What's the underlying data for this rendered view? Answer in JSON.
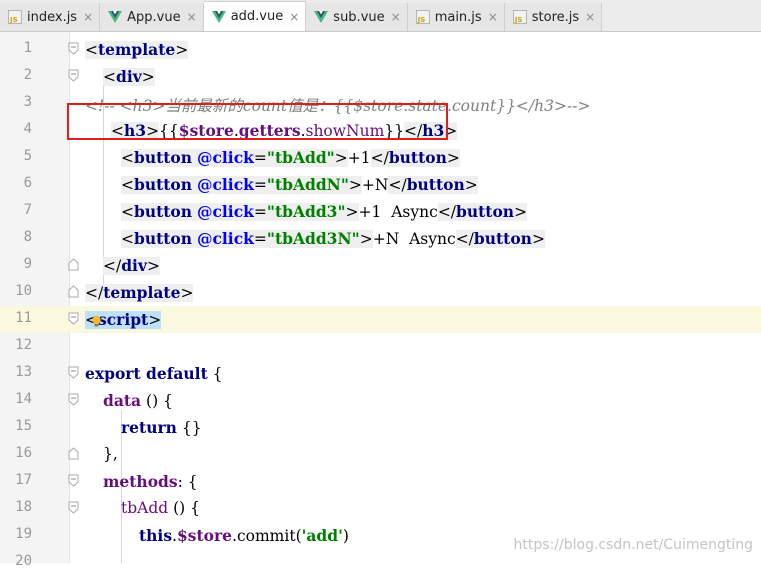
{
  "tabs": [
    {
      "label": "index.js",
      "icon": "js-file-icon",
      "active": false
    },
    {
      "label": "App.vue",
      "icon": "vue-file-icon",
      "active": false
    },
    {
      "label": "add.vue",
      "icon": "vue-file-icon",
      "active": true
    },
    {
      "label": "sub.vue",
      "icon": "vue-file-icon",
      "active": false
    },
    {
      "label": "main.js",
      "icon": "js-file-icon",
      "active": false
    },
    {
      "label": "store.js",
      "icon": "js-file-icon",
      "active": false
    }
  ],
  "close_glyph": "×",
  "code": {
    "lines": [
      "1",
      "2",
      "3",
      "4",
      "5",
      "6",
      "7",
      "8",
      "9",
      "10",
      "11",
      "12",
      "13",
      "14",
      "15",
      "16",
      "17",
      "18",
      "19",
      "20"
    ],
    "t_template": "template",
    "t_div": "div",
    "comment": "<!-- <h3>当前最新的count值是：{{$store.state.count}}</h3>-->",
    "t_h3": "h3",
    "mustache_open": "{{",
    "store_ref": "$store",
    "getters": "getters",
    "showNum": "showNum",
    "mustache_close": "}}",
    "t_button": "button",
    "at_click": "@click",
    "btn1_handler": "\"tbAdd\"",
    "btn1_text": "+1",
    "btn2_handler": "\"tbAddN\"",
    "btn2_text": "+N",
    "btn3_handler": "\"tbAdd3\"",
    "btn3_text": "+1  Async",
    "btn4_handler": "\"tbAdd3N\"",
    "btn4_text": "+N  Async",
    "t_script": "script",
    "export_default": "export default",
    "data_fn": "data",
    "return_kw": "return",
    "return_val": " {}",
    "close_brace_comma": "},",
    "methods": "methods",
    "tbAdd": "tbAdd",
    "this_kw": "this",
    "commit": "commit",
    "commit_arg": "'add'"
  },
  "watermark": "https://blog.csdn.net/Cuimengting",
  "colors": {
    "highlight_box": "#e01e1e",
    "tag": "#000080",
    "attribute": "#0000ff",
    "string": "#008000",
    "property": "#660e7a",
    "comment": "#808080"
  }
}
